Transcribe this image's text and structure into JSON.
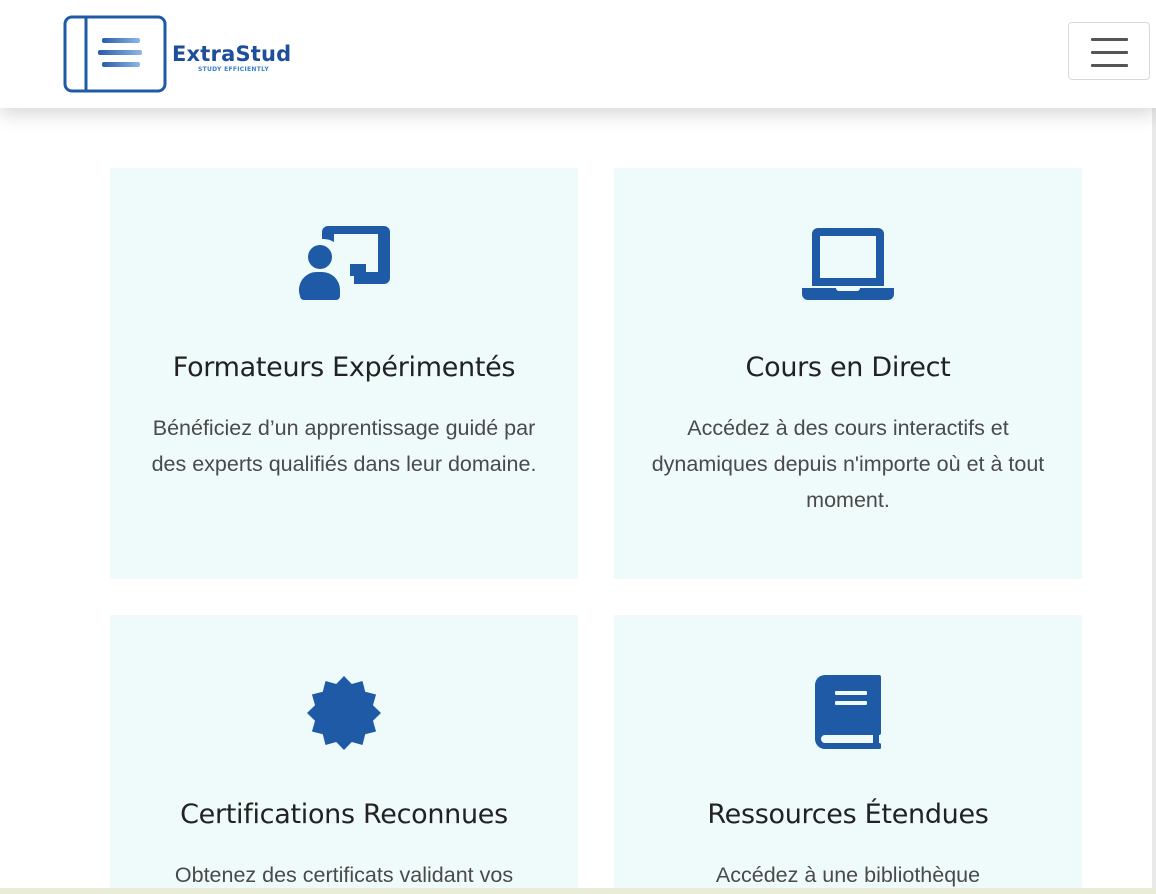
{
  "header": {
    "brand_name": "ExtraStud",
    "brand_tagline": "STUDY EFFICIENTLY",
    "menu_toggle_icon": "hamburger-icon"
  },
  "colors": {
    "primary": "#1f5aa6",
    "card_background": "#effbfb"
  },
  "features": [
    {
      "icon": "chalkboard-teacher-icon",
      "title": "Formateurs Expérimentés",
      "description": "Bénéficiez d’un apprentissage guidé par des experts qualifiés dans leur domaine."
    },
    {
      "icon": "laptop-icon",
      "title": "Cours en Direct",
      "description": "Accédez à des cours interactifs et dynamiques depuis n'importe où et à tout moment."
    },
    {
      "icon": "certificate-icon",
      "title": "Certifications Reconnues",
      "description": "Obtenez des certificats validant vos"
    },
    {
      "icon": "book-icon",
      "title": "Ressources Étendues",
      "description": "Accédez à une bibliothèque"
    }
  ]
}
